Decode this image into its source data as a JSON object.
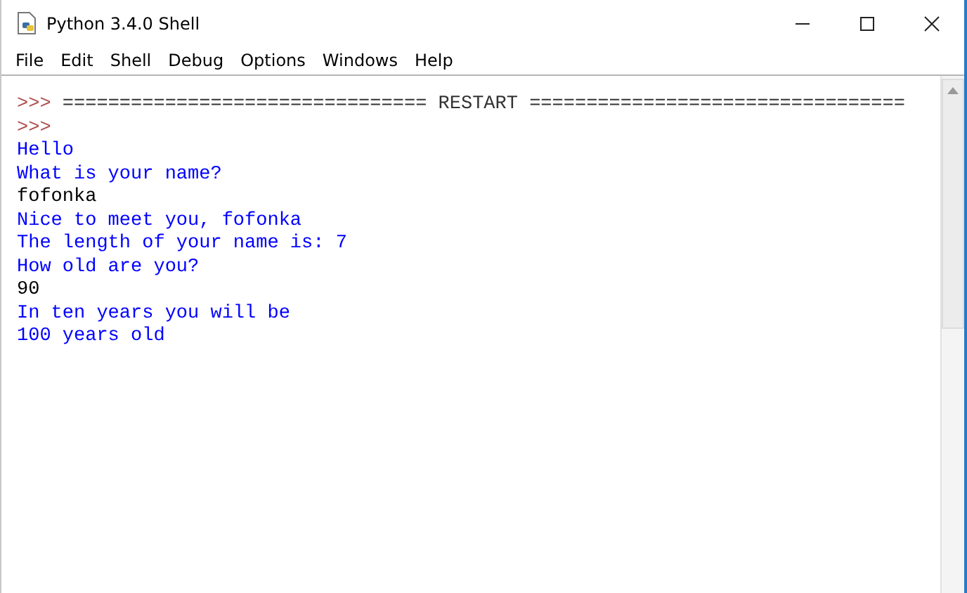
{
  "window": {
    "title": "Python 3.4.0 Shell"
  },
  "menu": [
    "File",
    "Edit",
    "Shell",
    "Debug",
    "Options",
    "Windows",
    "Help"
  ],
  "lines": [
    {
      "kind": "prompt",
      "prompt": ">>>",
      "text": "================================ RESTART ================================="
    },
    {
      "kind": "prompt",
      "prompt": ">>>"
    },
    {
      "kind": "output",
      "text": "Hello"
    },
    {
      "kind": "output",
      "text": "What is your name?"
    },
    {
      "kind": "input",
      "text": "fofonka"
    },
    {
      "kind": "output",
      "text": "Nice to meet you, fofonka"
    },
    {
      "kind": "output",
      "text": "The length of your name is: 7"
    },
    {
      "kind": "output",
      "text": "How old are you?"
    },
    {
      "kind": "input",
      "text": "90"
    },
    {
      "kind": "output",
      "text": "In ten years you will be"
    },
    {
      "kind": "output",
      "text": "100 years old"
    }
  ]
}
